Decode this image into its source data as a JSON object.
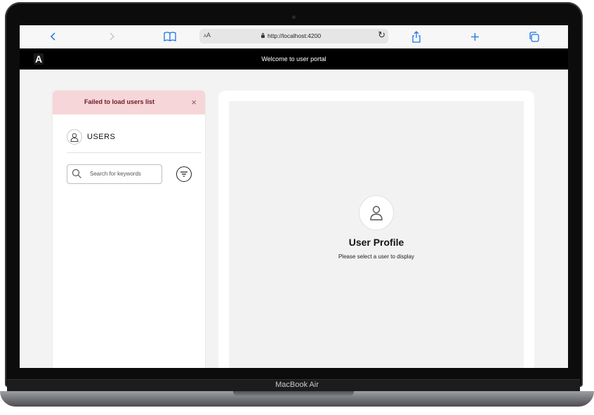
{
  "browser": {
    "url": "http://localhost:4200",
    "aa_label_small": "A",
    "aa_label_large": "A"
  },
  "app": {
    "title": "Welcome to user portal",
    "logo_letter": "A"
  },
  "alert": {
    "message": "Failed to load users list",
    "close_glyph": "×"
  },
  "users_panel": {
    "heading": "USERS",
    "search_placeholder": "Search for keywords"
  },
  "profile": {
    "title": "User Profile",
    "subtitle": "Please select a user to display"
  },
  "device": {
    "model": "MacBook Air"
  },
  "colors": {
    "accent": "#1a73e8",
    "appbar": "#000000",
    "alert_bg": "#f6d6d8",
    "alert_text": "#6d1a22"
  }
}
